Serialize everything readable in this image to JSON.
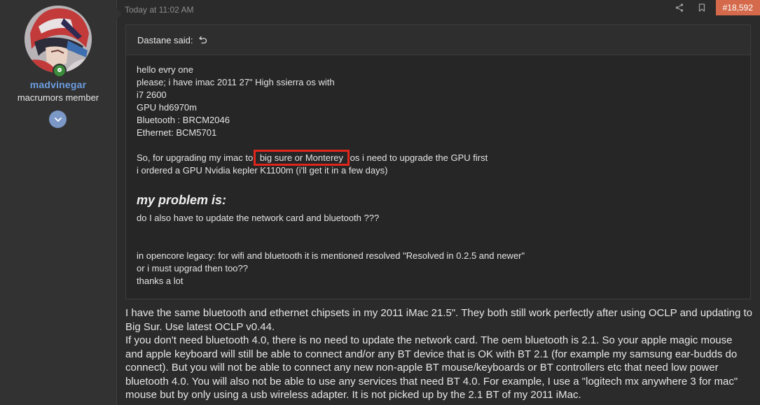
{
  "user": {
    "name": "madvinegar",
    "title": "macrumors member",
    "colors": {
      "name": "#6c9ee0",
      "online": "#3b8c3b",
      "expand": "#7b98c7"
    }
  },
  "post": {
    "timestamp": "Today at 11:02 AM",
    "number": "#18,592",
    "number_color": "#d46a4b",
    "icons": [
      "share-icon",
      "bookmark-icon"
    ]
  },
  "quote": {
    "author_label": "Dastane said:",
    "lines_top": [
      "hello evry one",
      "please; i have imac 2011 27\" High ssierra os with",
      "i7 2600",
      "GPU hd6970m",
      "Bluetooth : BRCM2046",
      "Ethernet: BCM5701"
    ],
    "upgrade_before": "So, for upgrading my imac to ",
    "upgrade_highlight": "big sure or Monterey",
    "upgrade_after": " os i need to upgrade the GPU first",
    "gpu_line": "i ordered a GPU Nvidia kepler K1100m (i'll get it in a few days)",
    "problem_heading": "my problem is:",
    "problem_line": "do I also have to update the network card and bluetooth ???",
    "lines_bottom": [
      "in opencore legacy: for wifi and bluetooth it is mentioned resolved \"Resolved in 0.2.5 and newer\"",
      "or i must upgrad then too??",
      "thanks a lot"
    ]
  },
  "reply": {
    "para1": "I have the same bluetooth and ethernet chipsets in my 2011 iMac 21.5\". They both still work perfectly after using OCLP and updating to Big Sur. Use latest OCLP v0.44.",
    "para2": "If you don't need bluetooth 4.0, there is no need to update the network card. The oem bluetooth is 2.1. So your apple magic mouse and apple keyboard will still be able to connect and/or any BT device that is OK with BT 2.1 (for example my samsung ear-budds do connect). But you will not be able to connect any new non-apple BT mouse/keyboards or BT controllers etc that need low power bluetooth 4.0. You will also not be able to use any services that need BT 4.0. For example, I use a \"logitech mx anywhere 3 for mac\" mouse but by only using a usb wireless adapter. It is not picked up by the 2.1 BT of my 2011 iMac."
  }
}
